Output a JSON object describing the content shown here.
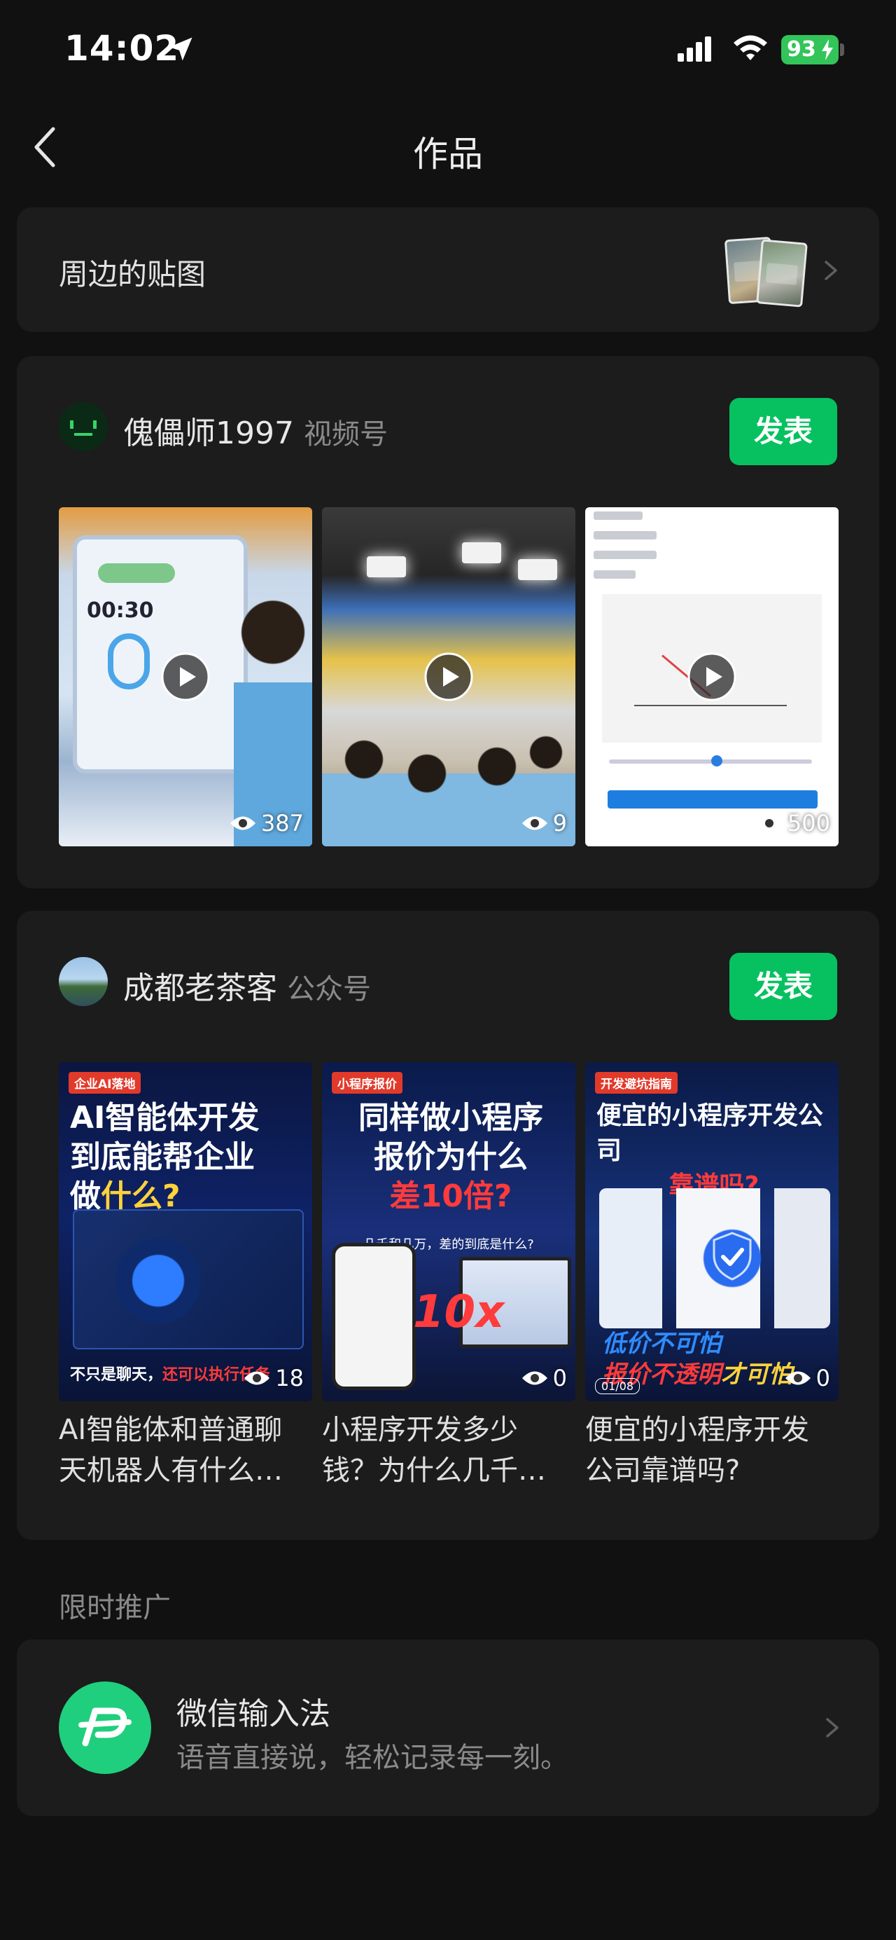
{
  "status_bar": {
    "time": "14:02",
    "battery": "93",
    "icons": [
      "location-arrow-icon",
      "cellular-signal-icon",
      "wifi-icon",
      "battery-charging-icon"
    ]
  },
  "nav": {
    "title": "作品",
    "back_icon": "chevron-left-icon"
  },
  "stickers": {
    "label": "周边的贴图"
  },
  "video_account": {
    "name": "傀儡师1997",
    "type": "视频号",
    "publish_label": "发表",
    "videos": [
      {
        "views": "387",
        "screen_timer": "00:30"
      },
      {
        "views": "9"
      },
      {
        "views": "500"
      }
    ]
  },
  "article_account": {
    "name": "成都老茶客",
    "type": "公众号",
    "publish_label": "发表",
    "articles": [
      {
        "tag": "企业AI落地",
        "cover_line1": "AI智能体开发",
        "cover_line2": "到底能帮企业",
        "cover_line3a": "做",
        "cover_line3b": "什么?",
        "cover_footer_a": "不只是聊天，",
        "cover_footer_b": "还可以执行任务",
        "views": "18",
        "caption": "AI智能体和普通聊天机器人有什么区别？"
      },
      {
        "tag": "小程序报价",
        "cover_line1": "同样做小程序",
        "cover_line2": "报价为什么",
        "cover_line3": "差10倍?",
        "cover_sub": "几千和几万，差的到底是什么?",
        "cover_big": "10x",
        "views": "0",
        "caption": "小程序开发多少钱？为什么几千和几万都有？"
      },
      {
        "tag": "开发避坑指南",
        "cover_line1": "便宜的小程序开发公司",
        "cover_line2": "靠谱吗?",
        "cover_bottom1": "低价不可怕",
        "cover_bottom2a": "报价不透明",
        "cover_bottom2b": "才可怕",
        "page_badge": "01/08",
        "views": "0",
        "caption": "便宜的小程序开发公司靠谱吗?"
      }
    ]
  },
  "promo": {
    "section_label": "限时推广",
    "title": "微信输入法",
    "description": "语音直接说，轻松记录每一刻。",
    "icon": "wechat-input-method-icon"
  },
  "colors": {
    "background": "#111111",
    "card": "#1c1c1c",
    "accent_green": "#07c160",
    "secondary_text": "#8a8a8a"
  }
}
